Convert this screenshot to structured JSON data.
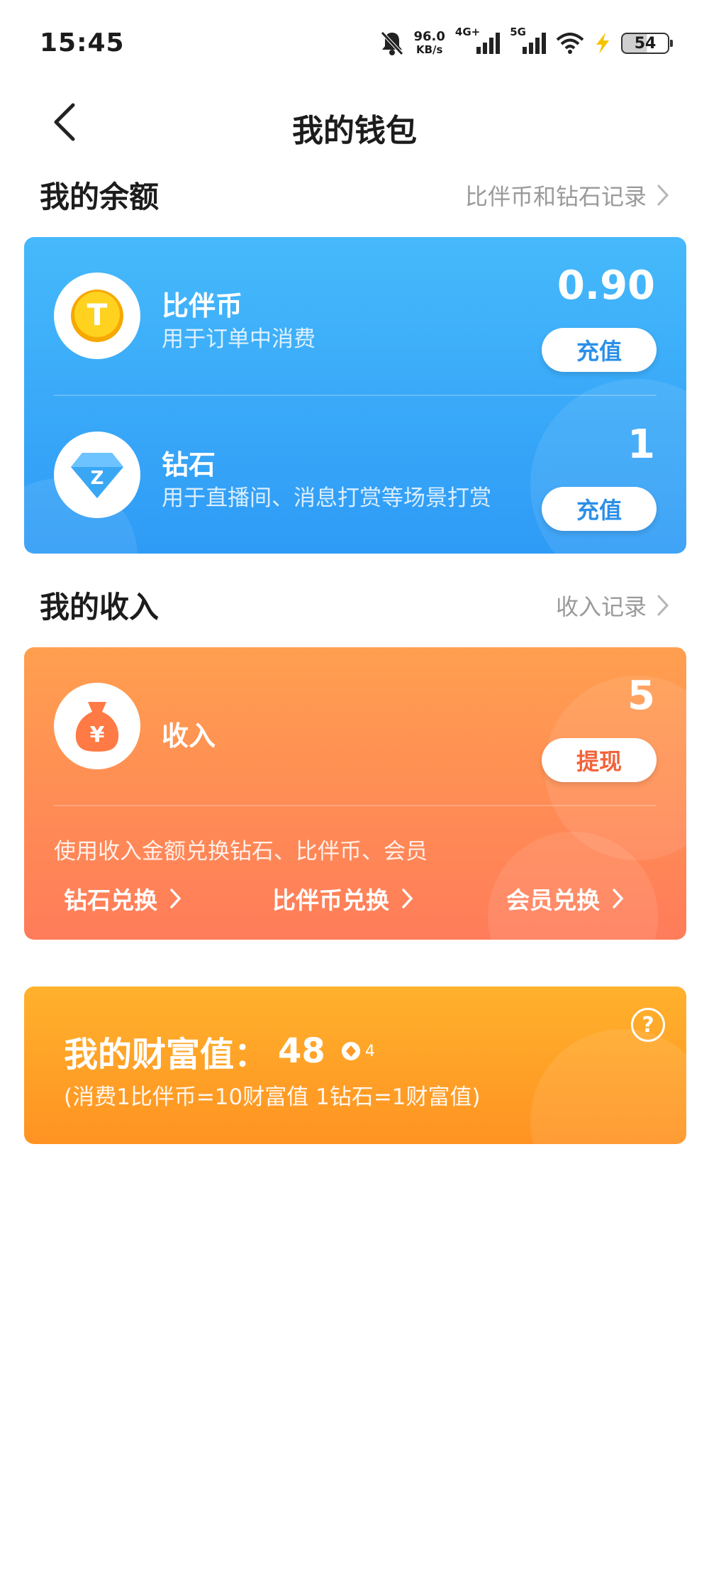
{
  "status_bar": {
    "time": "15:45",
    "net_speed": "96.0",
    "net_speed_unit": "KB/s",
    "signal1_label": "4G+",
    "signal2_label": "5G",
    "battery": "54",
    "icons": [
      "bell-off-icon",
      "signal-icon",
      "wifi-icon",
      "charging-icon",
      "battery-icon"
    ]
  },
  "header": {
    "title": "我的钱包"
  },
  "balance_section": {
    "title": "我的余额",
    "link": "比伴币和钻石记录"
  },
  "balance_card": {
    "coin": {
      "name": "比伴币",
      "desc": "用于订单中消费",
      "amount": "0.90",
      "button": "充值",
      "icon_letter": "T"
    },
    "diamond": {
      "name": "钻石",
      "desc": "用于直播间、消息打赏等场景打赏",
      "amount": "1",
      "button": "充值",
      "icon_letter": "Z"
    }
  },
  "income_section": {
    "title": "我的收入",
    "link": "收入记录"
  },
  "income_card": {
    "name": "收入",
    "amount": "5",
    "button": "提现",
    "icon_symbol": "¥",
    "note": "使用收入金额兑换钻石、比伴币、会员",
    "exchanges": [
      "钻石兑换",
      "比伴币兑换",
      "会员兑换"
    ]
  },
  "wealth_card": {
    "label": "我的财富值：",
    "value": "48",
    "level": "4",
    "note": "(消费1比伴币=10财富值 1钻石=1财富值)",
    "help": "?"
  },
  "colors": {
    "balance_card": "#2e9bf6",
    "income_card": "#ff8a4e",
    "wealth_card": "#ffa326",
    "blue_text": "#2b8fe8",
    "orange_text": "#f2633a",
    "muted_text": "#9a9a9a"
  }
}
